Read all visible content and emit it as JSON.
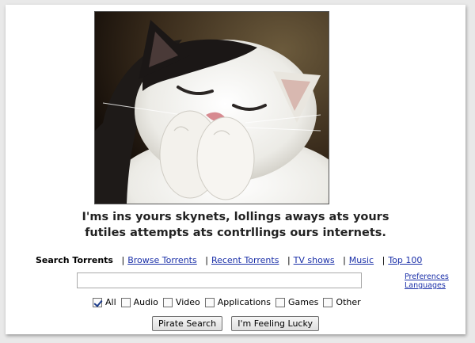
{
  "image": {
    "alt_icon": "lolcat-laughing-image"
  },
  "caption": {
    "line1": "I'ms ins yours skynets, lollings aways ats yours",
    "line2": "futiles attempts ats contrllings ours internets."
  },
  "nav": {
    "current": "Search Torrents",
    "links": [
      "Browse Torrents",
      "Recent Torrents",
      "TV shows",
      "Music",
      "Top 100"
    ]
  },
  "search": {
    "value": "",
    "placeholder": ""
  },
  "side_links": {
    "preferences": "Preferences",
    "languages": "Languages"
  },
  "categories": [
    {
      "label": "All",
      "checked": true
    },
    {
      "label": "Audio",
      "checked": false
    },
    {
      "label": "Video",
      "checked": false
    },
    {
      "label": "Applications",
      "checked": false
    },
    {
      "label": "Games",
      "checked": false
    },
    {
      "label": "Other",
      "checked": false
    }
  ],
  "buttons": {
    "search": "Pirate Search",
    "lucky": "I'm Feeling Lucky"
  },
  "colors": {
    "link": "#1a2fa8",
    "background": "#ffffff"
  }
}
